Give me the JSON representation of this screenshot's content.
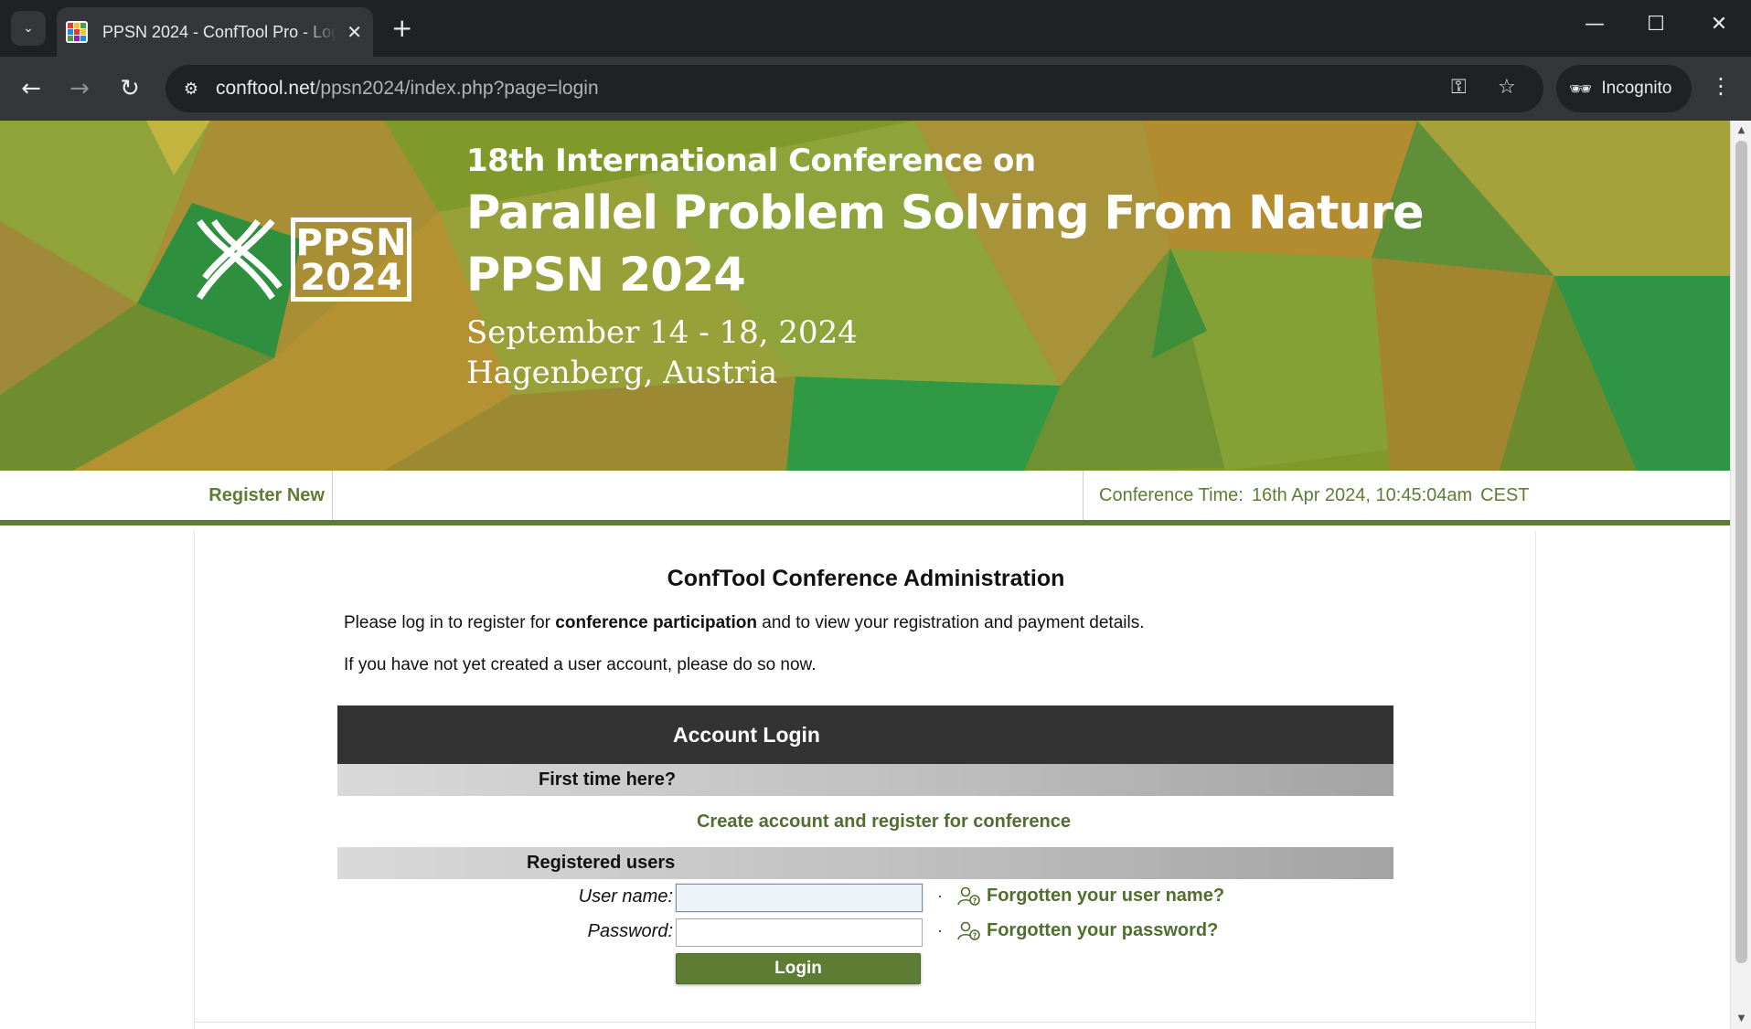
{
  "browser": {
    "tab_title": "PPSN 2024 - ConfTool Pro - Login",
    "url_domain": "conftool.net",
    "url_path": "/ppsn2024/index.php?page=login",
    "profile_label": "Incognito",
    "icons": {
      "tab_search": "chevron-down-icon",
      "close_tab": "close-icon",
      "new_tab": "plus-icon",
      "back": "arrow-left-icon",
      "forward": "arrow-right-icon",
      "reload": "reload-icon",
      "site_info": "tune-icon",
      "password": "key-icon",
      "bookmark": "star-icon",
      "menu": "vertical-dots-icon"
    }
  },
  "banner": {
    "logo_text_top": "PPSN",
    "logo_text_bottom": "2024",
    "line1": "18th International Conference on",
    "line2": "Parallel Problem Solving From Nature",
    "line3": "PPSN 2024",
    "line4": "September 14 - 18, 2024",
    "line5": "Hagenberg, Austria"
  },
  "nav": {
    "register_new": "Register New",
    "time_label": "Conference Time:",
    "time_value": "16th Apr 2024, 10:45:04am",
    "time_zone": "CEST"
  },
  "main": {
    "title": "ConfTool Conference Administration",
    "intro_before": "Please log in to register for ",
    "intro_bold": "conference participation",
    "intro_after": " and to view your registration and payment details.",
    "intro2": "If you have not yet created a user account, please do so now."
  },
  "login": {
    "header": "Account Login",
    "first_time": "First time here?",
    "create_link": "Create account and register for conference",
    "registered": "Registered users",
    "username_label": "User name:",
    "username_value": "",
    "password_label": "Password:",
    "password_value": "",
    "separator": "·",
    "forgot_user": "Forgotten your user name?",
    "forgot_password": "Forgotten your password?",
    "login_button": "Login"
  },
  "colors": {
    "accent_green": "#5d7d35",
    "link_green": "#4f6f2e",
    "header_dark": "#333333"
  }
}
